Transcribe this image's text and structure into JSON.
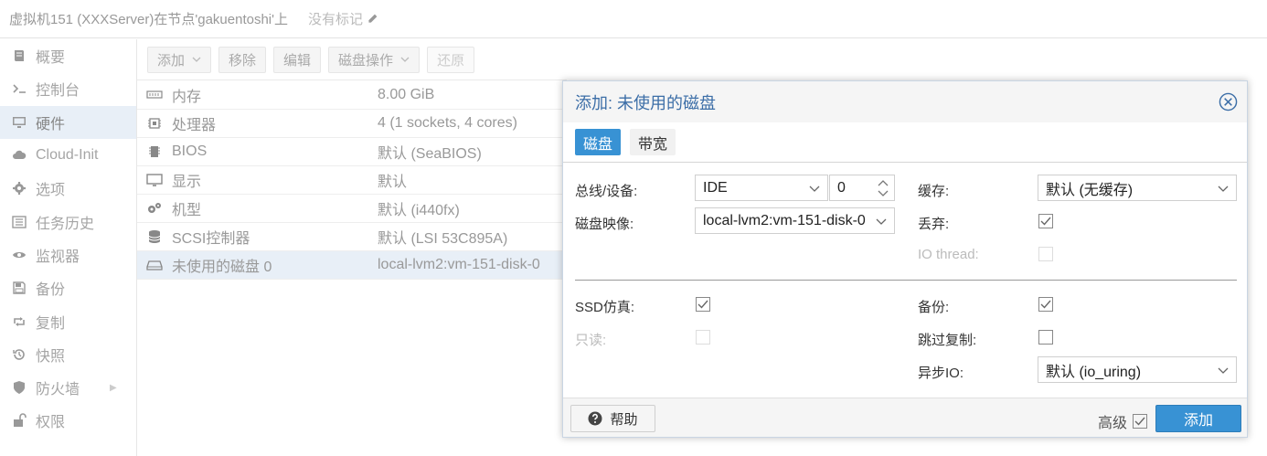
{
  "header": {
    "title": "虚拟机151 (XXXServer)在节点'gakuentoshi'上",
    "tags_label": "没有标记"
  },
  "nav": {
    "items": [
      {
        "label": "概要",
        "icon": "book-icon"
      },
      {
        "label": "控制台",
        "icon": "terminal-icon"
      },
      {
        "label": "硬件",
        "icon": "desktop-icon",
        "active": true
      },
      {
        "label": "Cloud-Init",
        "icon": "cloud-icon"
      },
      {
        "label": "选项",
        "icon": "gear-icon"
      },
      {
        "label": "任务历史",
        "icon": "list-icon"
      },
      {
        "label": "监视器",
        "icon": "eye-icon"
      },
      {
        "label": "备份",
        "icon": "floppy-icon"
      },
      {
        "label": "复制",
        "icon": "retweet-icon"
      },
      {
        "label": "快照",
        "icon": "history-icon"
      },
      {
        "label": "防火墙",
        "icon": "shield-icon"
      },
      {
        "label": "权限",
        "icon": "unlock-icon"
      }
    ]
  },
  "toolbar": {
    "add_label": "添加",
    "remove_label": "移除",
    "edit_label": "编辑",
    "disk_action_label": "磁盘操作",
    "revert_label": "还原"
  },
  "hardware": {
    "rows": [
      {
        "name": "内存",
        "value": "8.00 GiB",
        "icon": "memory-icon"
      },
      {
        "name": "处理器",
        "value": "4 (1 sockets, 4 cores)",
        "icon": "cpu-icon"
      },
      {
        "name": "BIOS",
        "value": "默认 (SeaBIOS)",
        "icon": "microchip-icon"
      },
      {
        "name": "显示",
        "value": "默认",
        "icon": "monitor-icon"
      },
      {
        "name": "机型",
        "value": "默认 (i440fx)",
        "icon": "cogs-icon"
      },
      {
        "name": "SCSI控制器",
        "value": "默认 (LSI 53C895A)",
        "icon": "database-icon"
      },
      {
        "name": "未使用的磁盘 0",
        "value": "local-lvm2:vm-151-disk-0",
        "icon": "hdd-icon",
        "selected": true
      }
    ]
  },
  "dialog": {
    "title": "添加: 未使用的磁盘",
    "tabs": [
      "磁盘",
      "带宽"
    ],
    "fields": {
      "bus_label": "总线/设备:",
      "bus_value": "IDE",
      "device_value": "0",
      "image_label": "磁盘映像:",
      "image_value": "local-lvm2:vm-151-disk-0",
      "cache_label": "缓存:",
      "cache_value": "默认 (无缓存)",
      "discard_label": "丢弃:",
      "discard_checked": true,
      "iothread_label": "IO thread:",
      "iothread_checked": false,
      "ssd_label": "SSD仿真:",
      "ssd_checked": true,
      "readonly_label": "只读:",
      "readonly_checked": false,
      "backup_label": "备份:",
      "backup_checked": true,
      "skip_repl_label": "跳过复制:",
      "skip_repl_checked": false,
      "async_io_label": "异步IO:",
      "async_io_value": "默认 (io_uring)"
    },
    "footer": {
      "help_label": "帮助",
      "advanced_label": "高级",
      "advanced_checked": true,
      "add_label": "添加"
    }
  },
  "colors": {
    "accent": "#3892d4",
    "title_blue": "#3c6ea7",
    "selected_row": "#e8eff7"
  }
}
